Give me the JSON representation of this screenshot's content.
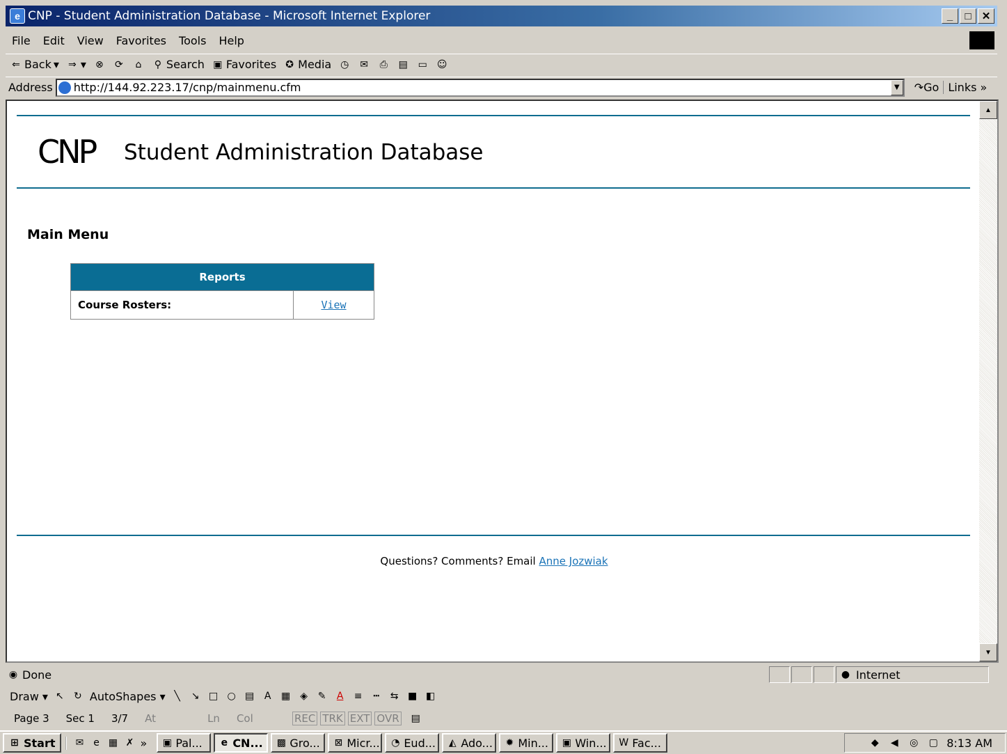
{
  "window": {
    "title": "CNP - Student Administration Database - Microsoft Internet Explorer"
  },
  "menu": [
    "File",
    "Edit",
    "View",
    "Favorites",
    "Tools",
    "Help"
  ],
  "toolbar": {
    "back": "Back",
    "search": "Search",
    "favorites": "Favorites",
    "media": "Media"
  },
  "address": {
    "label": "Address",
    "url": "http://144.92.223.17/cnp/mainmenu.cfm",
    "go": "Go",
    "links": "Links"
  },
  "page": {
    "logo": "CNP",
    "title": "Student Administration Database",
    "section": "Main Menu",
    "reports": {
      "header": "Reports",
      "row_label": "Course Rosters:",
      "row_link": "View"
    },
    "footer": {
      "text": "Questions? Comments? Email",
      "link": "Anne Jozwiak"
    }
  },
  "status": {
    "text": "Done",
    "zone": "Internet"
  },
  "drawbar": {
    "draw": "Draw",
    "autoshapes": "AutoShapes"
  },
  "wordstatus": {
    "page": "Page 3",
    "sec": "Sec 1",
    "pages": "3/7",
    "at": "At",
    "ln": "Ln",
    "col": "Col",
    "rec": "REC",
    "trk": "TRK",
    "ext": "EXT",
    "ovr": "OVR"
  },
  "taskbar": {
    "start": "Start",
    "tasks": [
      "Pal...",
      "CN...",
      "Gro...",
      "Micr...",
      "Eud...",
      "Ado...",
      "Min...",
      "Win...",
      "Fac..."
    ],
    "clock": "8:13 AM"
  }
}
